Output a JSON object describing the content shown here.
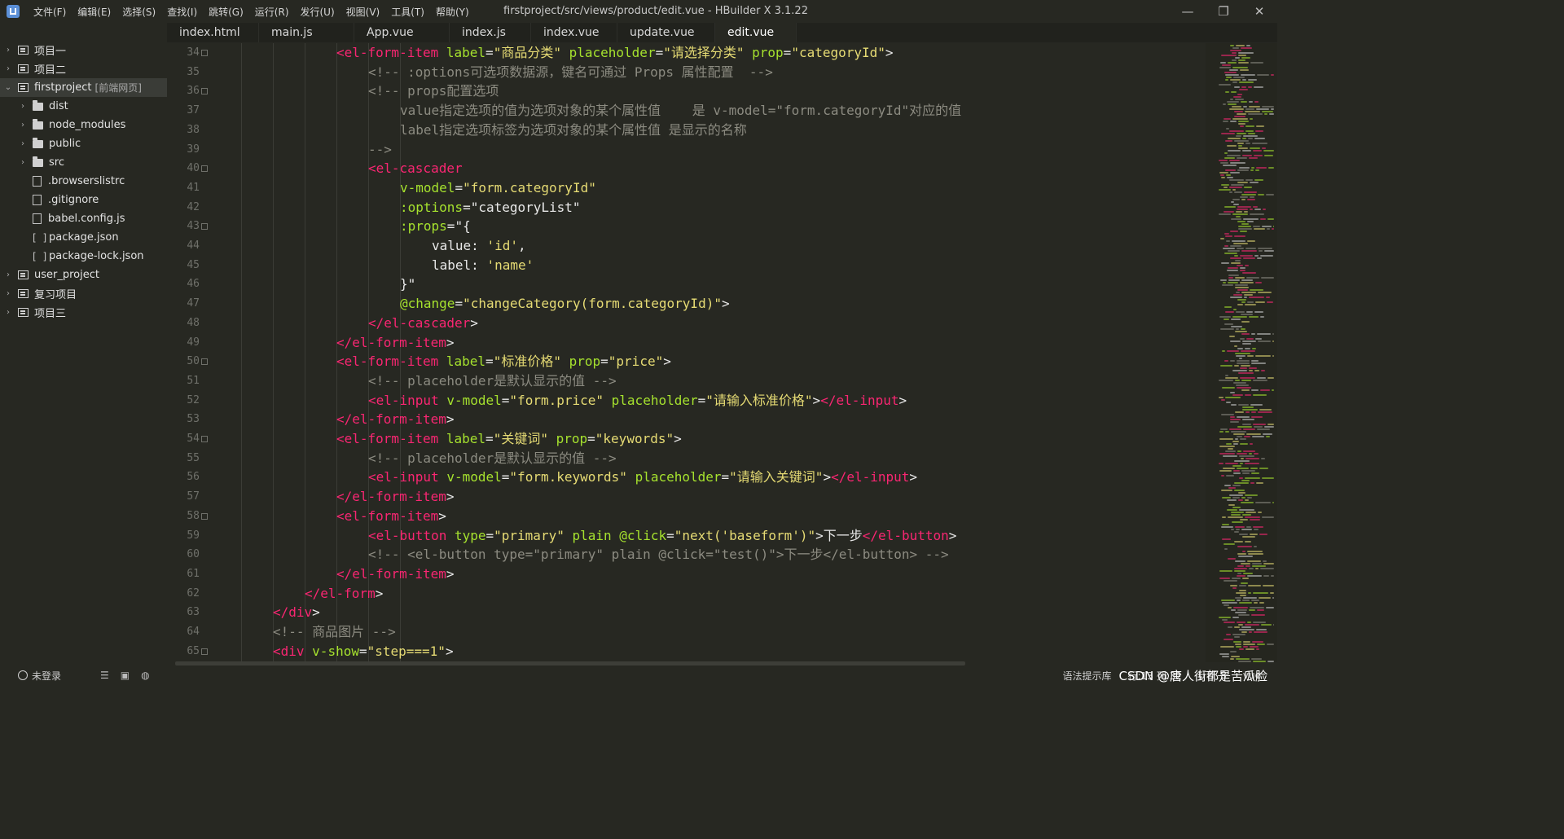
{
  "window": {
    "title": "firstproject/src/views/product/edit.vue - HBuilder X 3.1.22",
    "menu": [
      "文件(F)",
      "编辑(E)",
      "选择(S)",
      "查找(I)",
      "跳转(G)",
      "运行(R)",
      "发行(U)",
      "视图(V)",
      "工具(T)",
      "帮助(Y)"
    ],
    "controls": {
      "minimize": "—",
      "restore": "❐",
      "close": "✕"
    }
  },
  "tabs": [
    {
      "label": "index.html",
      "active": false
    },
    {
      "label": "main.js",
      "active": false
    },
    {
      "label": "App.vue",
      "active": false
    },
    {
      "label": "index.js",
      "active": false
    },
    {
      "label": "index.vue",
      "active": false
    },
    {
      "label": "update.vue",
      "active": false
    },
    {
      "label": "edit.vue",
      "active": true
    }
  ],
  "sidebar": {
    "items": [
      {
        "label": "项目一",
        "type": "project",
        "expanded": false,
        "depth": 0
      },
      {
        "label": "项目二",
        "type": "project",
        "expanded": false,
        "depth": 0
      },
      {
        "label": "firstproject",
        "tag": "[前端网页]",
        "type": "project",
        "expanded": true,
        "depth": 0,
        "selected": true
      },
      {
        "label": "dist",
        "type": "folder",
        "expanded": false,
        "depth": 1
      },
      {
        "label": "node_modules",
        "type": "folder",
        "expanded": false,
        "depth": 1
      },
      {
        "label": "public",
        "type": "folder",
        "expanded": false,
        "depth": 1
      },
      {
        "label": "src",
        "type": "folder",
        "expanded": false,
        "depth": 1
      },
      {
        "label": ".browserslistrc",
        "type": "file",
        "depth": 1
      },
      {
        "label": ".gitignore",
        "type": "file",
        "depth": 1
      },
      {
        "label": "babel.config.js",
        "type": "file",
        "depth": 1
      },
      {
        "label": "package.json",
        "type": "json",
        "depth": 1
      },
      {
        "label": "package-lock.json",
        "type": "json",
        "depth": 1
      },
      {
        "label": "user_project",
        "type": "project",
        "expanded": false,
        "depth": 0
      },
      {
        "label": "复习项目",
        "type": "project",
        "expanded": false,
        "depth": 0
      },
      {
        "label": "项目三",
        "type": "project",
        "expanded": false,
        "depth": 0
      }
    ]
  },
  "editor": {
    "lines": [
      {
        "n": "34",
        "fold": true,
        "indent": 12,
        "tokens": [
          [
            "tag",
            "<el-form-item"
          ],
          [
            "text",
            " "
          ],
          [
            "attr",
            "label"
          ],
          [
            "punc",
            "="
          ],
          [
            "str",
            "\"商品分类\""
          ],
          [
            "text",
            " "
          ],
          [
            "attr",
            "placeholder"
          ],
          [
            "punc",
            "="
          ],
          [
            "str",
            "\"请选择分类\""
          ],
          [
            "text",
            " "
          ],
          [
            "attr",
            "prop"
          ],
          [
            "punc",
            "="
          ],
          [
            "str",
            "\"categoryId\""
          ],
          [
            "punc",
            ">"
          ]
        ]
      },
      {
        "n": "35",
        "fold": false,
        "indent": 16,
        "tokens": [
          [
            "cmt",
            "<!-- :options可选项数据源，键名可通过 Props 属性配置  -->"
          ]
        ]
      },
      {
        "n": "36",
        "fold": true,
        "indent": 16,
        "tokens": [
          [
            "cmt",
            "<!-- props配置选项"
          ]
        ]
      },
      {
        "n": "37",
        "fold": false,
        "indent": 20,
        "tokens": [
          [
            "cmt",
            "value指定选项的值为选项对象的某个属性值    是 v-model=\"form.categoryId\"对应的值"
          ]
        ]
      },
      {
        "n": "38",
        "fold": false,
        "indent": 20,
        "tokens": [
          [
            "cmt",
            "label指定选项标签为选项对象的某个属性值 是显示的名称"
          ]
        ]
      },
      {
        "n": "39",
        "fold": false,
        "indent": 16,
        "tokens": [
          [
            "cmt",
            "-->"
          ]
        ]
      },
      {
        "n": "40",
        "fold": true,
        "indent": 16,
        "tokens": [
          [
            "tag",
            "<el-cascader"
          ]
        ]
      },
      {
        "n": "41",
        "fold": false,
        "indent": 20,
        "tokens": [
          [
            "attr",
            "v-model"
          ],
          [
            "punc",
            "="
          ],
          [
            "str",
            "\"form.categoryId\""
          ]
        ]
      },
      {
        "n": "42",
        "fold": false,
        "indent": 20,
        "tokens": [
          [
            "attr",
            ":options"
          ],
          [
            "punc",
            "="
          ],
          [
            "text",
            "\"categoryList\""
          ]
        ]
      },
      {
        "n": "43",
        "fold": true,
        "indent": 20,
        "tokens": [
          [
            "attr",
            ":props"
          ],
          [
            "punc",
            "="
          ],
          [
            "text",
            "\"{"
          ]
        ]
      },
      {
        "n": "44",
        "fold": false,
        "indent": 24,
        "tokens": [
          [
            "text",
            "value: "
          ],
          [
            "str",
            "'id'"
          ],
          [
            "text",
            ","
          ]
        ]
      },
      {
        "n": "45",
        "fold": false,
        "indent": 24,
        "tokens": [
          [
            "text",
            "label: "
          ],
          [
            "str",
            "'name'"
          ]
        ]
      },
      {
        "n": "46",
        "fold": false,
        "indent": 20,
        "tokens": [
          [
            "text",
            "}\""
          ]
        ]
      },
      {
        "n": "47",
        "fold": false,
        "indent": 20,
        "tokens": [
          [
            "attr",
            "@change"
          ],
          [
            "punc",
            "="
          ],
          [
            "str",
            "\"changeCategory(form.categoryId)\""
          ],
          [
            "punc",
            ">"
          ]
        ]
      },
      {
        "n": "48",
        "fold": false,
        "indent": 16,
        "tokens": [
          [
            "tag",
            "</el-cascader"
          ],
          [
            "punc",
            ">"
          ]
        ]
      },
      {
        "n": "49",
        "fold": false,
        "indent": 12,
        "tokens": [
          [
            "tag",
            "</el-form-item"
          ],
          [
            "punc",
            ">"
          ]
        ]
      },
      {
        "n": "50",
        "fold": true,
        "indent": 12,
        "tokens": [
          [
            "tag",
            "<el-form-item"
          ],
          [
            "text",
            " "
          ],
          [
            "attr",
            "label"
          ],
          [
            "punc",
            "="
          ],
          [
            "str",
            "\"标准价格\""
          ],
          [
            "text",
            " "
          ],
          [
            "attr",
            "prop"
          ],
          [
            "punc",
            "="
          ],
          [
            "str",
            "\"price\""
          ],
          [
            "punc",
            ">"
          ]
        ]
      },
      {
        "n": "51",
        "fold": false,
        "indent": 16,
        "tokens": [
          [
            "cmt",
            "<!-- placeholder是默认显示的值 -->"
          ]
        ]
      },
      {
        "n": "52",
        "fold": false,
        "indent": 16,
        "tokens": [
          [
            "tag",
            "<el-input"
          ],
          [
            "text",
            " "
          ],
          [
            "attr",
            "v-model"
          ],
          [
            "punc",
            "="
          ],
          [
            "str",
            "\"form.price\""
          ],
          [
            "text",
            " "
          ],
          [
            "attr",
            "placeholder"
          ],
          [
            "punc",
            "="
          ],
          [
            "str",
            "\"请输入标准价格\""
          ],
          [
            "punc",
            ">"
          ],
          [
            "tag",
            "</el-input"
          ],
          [
            "punc",
            ">"
          ]
        ]
      },
      {
        "n": "53",
        "fold": false,
        "indent": 12,
        "tokens": [
          [
            "tag",
            "</el-form-item"
          ],
          [
            "punc",
            ">"
          ]
        ]
      },
      {
        "n": "54",
        "fold": true,
        "indent": 12,
        "tokens": [
          [
            "tag",
            "<el-form-item"
          ],
          [
            "text",
            " "
          ],
          [
            "attr",
            "label"
          ],
          [
            "punc",
            "="
          ],
          [
            "str",
            "\"关键词\""
          ],
          [
            "text",
            " "
          ],
          [
            "attr",
            "prop"
          ],
          [
            "punc",
            "="
          ],
          [
            "str",
            "\"keywords\""
          ],
          [
            "punc",
            ">"
          ]
        ]
      },
      {
        "n": "55",
        "fold": false,
        "indent": 16,
        "tokens": [
          [
            "cmt",
            "<!-- placeholder是默认显示的值 -->"
          ]
        ]
      },
      {
        "n": "56",
        "fold": false,
        "indent": 16,
        "tokens": [
          [
            "tag",
            "<el-input"
          ],
          [
            "text",
            " "
          ],
          [
            "attr",
            "v-model"
          ],
          [
            "punc",
            "="
          ],
          [
            "str",
            "\"form.keywords\""
          ],
          [
            "text",
            " "
          ],
          [
            "attr",
            "placeholder"
          ],
          [
            "punc",
            "="
          ],
          [
            "str",
            "\"请输入关键词\""
          ],
          [
            "punc",
            ">"
          ],
          [
            "tag",
            "</el-input"
          ],
          [
            "punc",
            ">"
          ]
        ]
      },
      {
        "n": "57",
        "fold": false,
        "indent": 12,
        "tokens": [
          [
            "tag",
            "</el-form-item"
          ],
          [
            "punc",
            ">"
          ]
        ]
      },
      {
        "n": "58",
        "fold": true,
        "indent": 12,
        "tokens": [
          [
            "tag",
            "<el-form-item"
          ],
          [
            "punc",
            ">"
          ]
        ]
      },
      {
        "n": "59",
        "fold": false,
        "indent": 16,
        "tokens": [
          [
            "tag",
            "<el-button"
          ],
          [
            "text",
            " "
          ],
          [
            "attr",
            "type"
          ],
          [
            "punc",
            "="
          ],
          [
            "str",
            "\"primary\""
          ],
          [
            "text",
            " "
          ],
          [
            "attr",
            "plain"
          ],
          [
            "text",
            " "
          ],
          [
            "attr",
            "@click"
          ],
          [
            "punc",
            "="
          ],
          [
            "str",
            "\"next('baseform')\""
          ],
          [
            "punc",
            ">"
          ],
          [
            "text",
            "下一步"
          ],
          [
            "tag",
            "</el-button"
          ],
          [
            "punc",
            ">"
          ]
        ]
      },
      {
        "n": "60",
        "fold": false,
        "indent": 16,
        "tokens": [
          [
            "cmt",
            "<!-- <el-button type=\"primary\" plain @click=\"test()\">下一步</el-button> -->"
          ]
        ]
      },
      {
        "n": "61",
        "fold": false,
        "indent": 12,
        "tokens": [
          [
            "tag",
            "</el-form-item"
          ],
          [
            "punc",
            ">"
          ]
        ]
      },
      {
        "n": "62",
        "fold": false,
        "indent": 8,
        "tokens": [
          [
            "tag",
            "</el-form"
          ],
          [
            "punc",
            ">"
          ]
        ]
      },
      {
        "n": "63",
        "fold": false,
        "indent": 4,
        "tokens": [
          [
            "tag",
            "</div"
          ],
          [
            "punc",
            ">"
          ]
        ]
      },
      {
        "n": "64",
        "fold": false,
        "indent": 4,
        "tokens": [
          [
            "cmt",
            "<!-- 商品图片 -->"
          ]
        ]
      },
      {
        "n": "65",
        "fold": true,
        "indent": 4,
        "tokens": [
          [
            "tag",
            "<div"
          ],
          [
            "text",
            " "
          ],
          [
            "attr",
            "v-show"
          ],
          [
            "punc",
            "="
          ],
          [
            "str",
            "\"step===1\""
          ],
          [
            "punc",
            ">"
          ]
        ]
      }
    ]
  },
  "statusbar": {
    "user": "未登录",
    "icons": [
      "list-icon",
      "terminal-icon",
      "globe-icon"
    ],
    "syntax_hint": "语法提示库",
    "position": "行:13  列:32",
    "encoding": "UTF-8",
    "language": "vue"
  },
  "watermark": "CSDN @唐人街都是苦瓜脸",
  "colors": {
    "background": "#272822",
    "tag": "#f92672",
    "attribute": "#a6e22e",
    "string": "#e6db74",
    "comment": "#8c8b81"
  }
}
